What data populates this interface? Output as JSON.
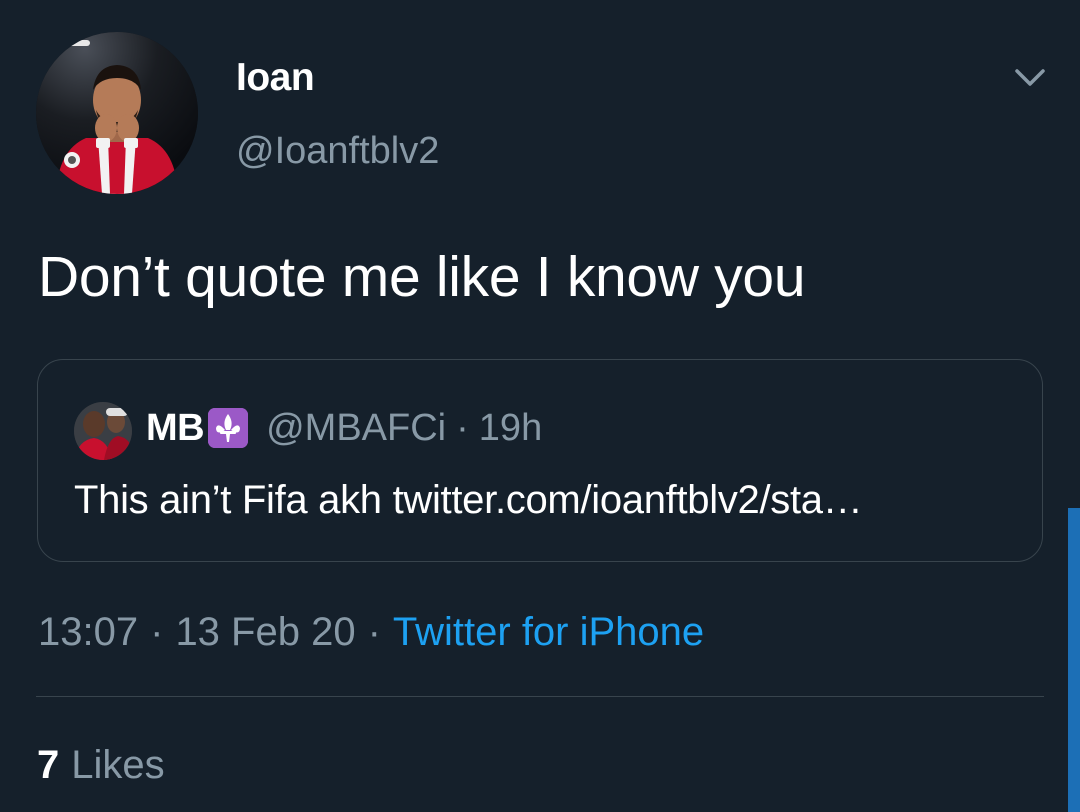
{
  "tweet": {
    "author": {
      "display_name": "Ioan",
      "handle": "@Ioanftblv2"
    },
    "menu_icon": "chevron-down-icon",
    "text": "Don’t quote me like I know you",
    "quoted": {
      "display_name": "MB",
      "emoji": "fleur-de-lis-emoji",
      "handle": "@MBAFCi",
      "separator": "·",
      "time": "19h",
      "text": "This ain’t Fifa akh twitter.com/ioanftblv2/sta…"
    },
    "meta": {
      "time": "13:07",
      "separator": "·",
      "date": "13 Feb 20",
      "separator2": "·",
      "source": "Twitter for iPhone"
    },
    "likes": {
      "count": "7",
      "label": "Likes"
    }
  },
  "colors": {
    "background": "#15202b",
    "secondary_text": "#8899a6",
    "link": "#1da1f2",
    "border": "#38444d"
  }
}
